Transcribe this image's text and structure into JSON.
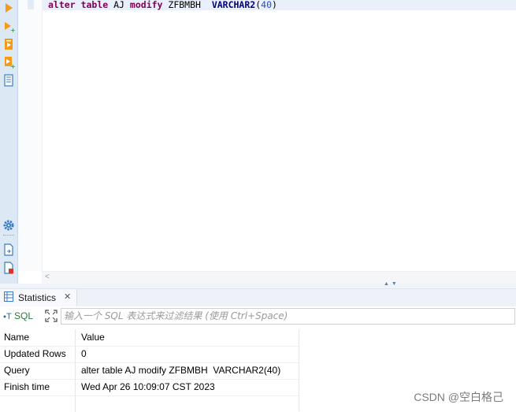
{
  "editor": {
    "code": {
      "kw1": "alter",
      "kw2": "table",
      "ident1": "AJ",
      "kw3": "modify",
      "ident2": "ZFBMBH",
      "type": "VARCHAR2",
      "open": "(",
      "num": "40",
      "close": ")"
    },
    "toolbar_icons": [
      "execute-statement-icon",
      "execute-statement-new-tab-icon",
      "execute-script-icon",
      "execute-script-new-tab-icon",
      "explain-plan-icon",
      "settings-icon",
      "export-icon",
      "delete-document-icon"
    ],
    "scroll_left_glyph": "<"
  },
  "panel": {
    "tab_label": "Statistics",
    "tab_close_glyph": "✕",
    "sql_toggle_label": "SQL",
    "sql_toggle_prefix": "⬩T",
    "filter_placeholder": "输入一个 SQL 表达式来过滤结果 (使用 Ctrl+Space)",
    "columns": {
      "name": "Name",
      "value": "Value"
    },
    "rows": [
      {
        "name": "Updated Rows",
        "value": "0"
      },
      {
        "name": "Query",
        "value": "alter table AJ modify ZFBMBH  VARCHAR2(40)"
      },
      {
        "name": "Finish time",
        "value": "Wed Apr 26 10:09:07 CST 2023"
      }
    ]
  },
  "watermark": "CSDN @空白格己",
  "colors": {
    "keyword": "#7f0055",
    "type": "#000080",
    "number": "#1750eb",
    "accent": "#f0a020"
  }
}
